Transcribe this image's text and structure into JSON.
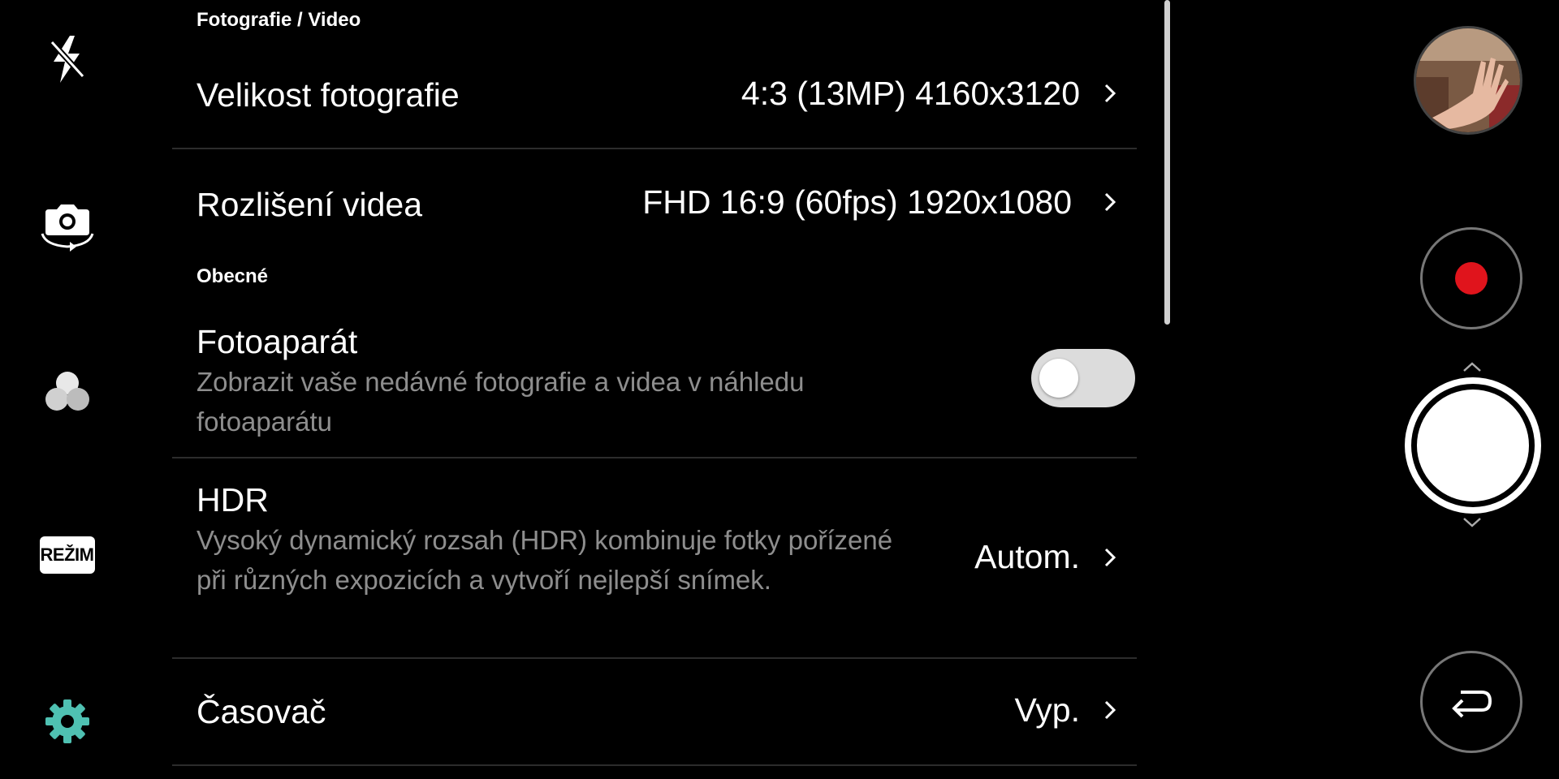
{
  "left_rail": {
    "flash_icon": "flash-off-icon",
    "switch_camera_icon": "switch-camera-icon",
    "filter_icon": "filter-icon",
    "mode_label": "REŽIM",
    "settings_icon": "gear-icon",
    "settings_color": "#4fc1b2"
  },
  "settings": {
    "sections": [
      {
        "header": "Fotografie / Video",
        "items": [
          {
            "title": "Velikost fotografie",
            "value": "4:3 (13MP) 4160x3120"
          },
          {
            "title": "Rozlišení videa",
            "value": "FHD 16:9 (60fps) 1920x1080"
          }
        ]
      },
      {
        "header": "Obecné",
        "items": [
          {
            "title": "Fotoaparát",
            "description": "Zobrazit vaše nedávné fotografie a videa v náhledu fotoaparátu",
            "toggle_on": false
          },
          {
            "title": "HDR",
            "description": "Vysoký dynamický rozsah (HDR) kombinuje fotky pořízené při různých expozicích a vytvoří nejlepší snímek.",
            "value": "Autom."
          },
          {
            "title": "Časovač",
            "value": "Vyp."
          }
        ]
      }
    ]
  },
  "right_rail": {
    "gallery_thumbnail": "gallery-thumbnail",
    "record_color": "#e0141c",
    "shutter": "shutter-button",
    "back_icon": "back-icon"
  }
}
